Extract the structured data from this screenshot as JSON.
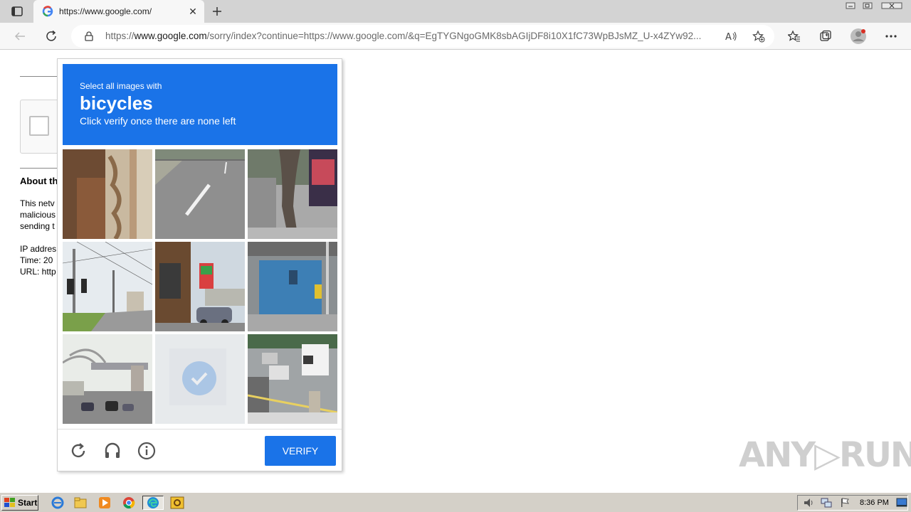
{
  "browser": {
    "tab_title": "https://www.google.com/",
    "tab_close": "✕",
    "url_prefix": "https://",
    "url_host": "www.google.com",
    "url_rest": "/sorry/index?continue=https://www.google.com/&q=EgTYGNgoGMK8sbAGIjDF8i10X1fC73WpBJsMZ_U-x4ZYw92..."
  },
  "page": {
    "about_heading": "About th",
    "para_line1": "This netv",
    "para_line2": "malicious",
    "para_line3": "sending t",
    "ip_line": "IP addres",
    "time_line": "Time: 20",
    "url_line": "URL: http"
  },
  "challenge": {
    "instruction_small": "Select all images with",
    "target": "bicycles",
    "instruction_sub": "Click verify once there are none left",
    "verify_label": "VERIFY",
    "tiles": [
      {
        "id": 1,
        "selected": false
      },
      {
        "id": 2,
        "selected": false
      },
      {
        "id": 3,
        "selected": false
      },
      {
        "id": 4,
        "selected": false
      },
      {
        "id": 5,
        "selected": false
      },
      {
        "id": 6,
        "selected": false
      },
      {
        "id": 7,
        "selected": false
      },
      {
        "id": 8,
        "selected": true
      },
      {
        "id": 9,
        "selected": false
      }
    ]
  },
  "watermark": "ANY▷RUN",
  "taskbar": {
    "start_label": "Start",
    "clock": "8:36 PM"
  },
  "colors": {
    "accent": "#1a73e8",
    "taskbar": "#d4d0c8"
  }
}
